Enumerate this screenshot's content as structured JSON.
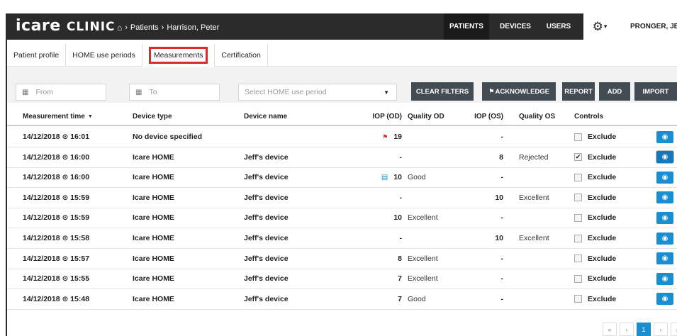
{
  "app": {
    "logo_brand": "icare",
    "logo_suffix": "CLINIC",
    "breadcrumb_separator_1": "›",
    "breadcrumb_patients": "Patients",
    "breadcrumb_separator_2": "›",
    "breadcrumb_patient": "Harrison, Peter"
  },
  "nav": {
    "patients": "PATIENTS",
    "devices": "DEVICES",
    "users": "USERS",
    "user_name": "PRONGER, JEFF"
  },
  "tabs": [
    {
      "label": "Patient profile"
    },
    {
      "label": "HOME use periods"
    },
    {
      "label": "Measurements"
    },
    {
      "label": "Certification"
    }
  ],
  "filters": {
    "from_placeholder": "From",
    "to_placeholder": "To",
    "period_placeholder": "Select HOME use period",
    "clear_filters": "CLEAR FILTERS",
    "acknowledge": "ACKNOWLEDGE",
    "report": "REPORT",
    "add": "ADD",
    "import": "IMPORT"
  },
  "table": {
    "headers": {
      "time": "Measurement time",
      "device_type": "Device type",
      "device_name": "Device name",
      "iop_od": "IOP (OD)",
      "quality_od": "Quality OD",
      "iop_os": "IOP (OS)",
      "quality_os": "Quality OS",
      "controls": "Controls"
    },
    "exclude_label": "Exclude",
    "rows": [
      {
        "time": "14/12/2018 ⊙ 16:01",
        "device_type": "No device specified",
        "device_name": "",
        "iop_od": "19",
        "quality_od": "",
        "iop_os": "-",
        "quality_os": "",
        "excluded": false,
        "flag": true,
        "note": false
      },
      {
        "time": "14/12/2018 ⊙ 16:00",
        "device_type": "Icare HOME",
        "device_name": "Jeff's device",
        "iop_od": "-",
        "quality_od": "",
        "iop_os": "8",
        "quality_os": "Rejected",
        "excluded": true,
        "flag": false,
        "note": false
      },
      {
        "time": "14/12/2018 ⊙ 16:00",
        "device_type": "Icare HOME",
        "device_name": "Jeff's device",
        "iop_od": "10",
        "quality_od": "Good",
        "iop_os": "-",
        "quality_os": "",
        "excluded": false,
        "flag": false,
        "note": true
      },
      {
        "time": "14/12/2018 ⊙ 15:59",
        "device_type": "Icare HOME",
        "device_name": "Jeff's device",
        "iop_od": "-",
        "quality_od": "",
        "iop_os": "10",
        "quality_os": "Excellent",
        "excluded": false,
        "flag": false,
        "note": false
      },
      {
        "time": "14/12/2018 ⊙ 15:59",
        "device_type": "Icare HOME",
        "device_name": "Jeff's device",
        "iop_od": "10",
        "quality_od": "Excellent",
        "iop_os": "-",
        "quality_os": "",
        "excluded": false,
        "flag": false,
        "note": false
      },
      {
        "time": "14/12/2018 ⊙ 15:58",
        "device_type": "Icare HOME",
        "device_name": "Jeff's device",
        "iop_od": "-",
        "quality_od": "",
        "iop_os": "10",
        "quality_os": "Excellent",
        "excluded": false,
        "flag": false,
        "note": false
      },
      {
        "time": "14/12/2018 ⊙ 15:57",
        "device_type": "Icare HOME",
        "device_name": "Jeff's device",
        "iop_od": "8",
        "quality_od": "Excellent",
        "iop_os": "-",
        "quality_os": "",
        "excluded": false,
        "flag": false,
        "note": false
      },
      {
        "time": "14/12/2018 ⊙ 15:55",
        "device_type": "Icare HOME",
        "device_name": "Jeff's device",
        "iop_od": "7",
        "quality_od": "Excellent",
        "iop_os": "-",
        "quality_os": "",
        "excluded": false,
        "flag": false,
        "note": false
      },
      {
        "time": "14/12/2018 ⊙ 15:48",
        "device_type": "Icare HOME",
        "device_name": "Jeff's device",
        "iop_od": "7",
        "quality_od": "Good",
        "iop_os": "-",
        "quality_os": "",
        "excluded": false,
        "flag": false,
        "note": false
      }
    ]
  },
  "pagination": {
    "first": "«",
    "prev": "‹",
    "current": "1",
    "next": "›",
    "last": "»"
  },
  "colors": {
    "topbar": "#2b2b2b",
    "accent_blue": "#1a8fcf",
    "highlight_red": "#d62d2d",
    "button_gray": "#444c53"
  },
  "icons": {
    "home": "home-icon",
    "gear": "gear-icon",
    "calendar": "calendar-icon",
    "flag": "flag-icon",
    "note": "note-icon",
    "eye": "eye-icon",
    "clock": "clock-icon"
  }
}
